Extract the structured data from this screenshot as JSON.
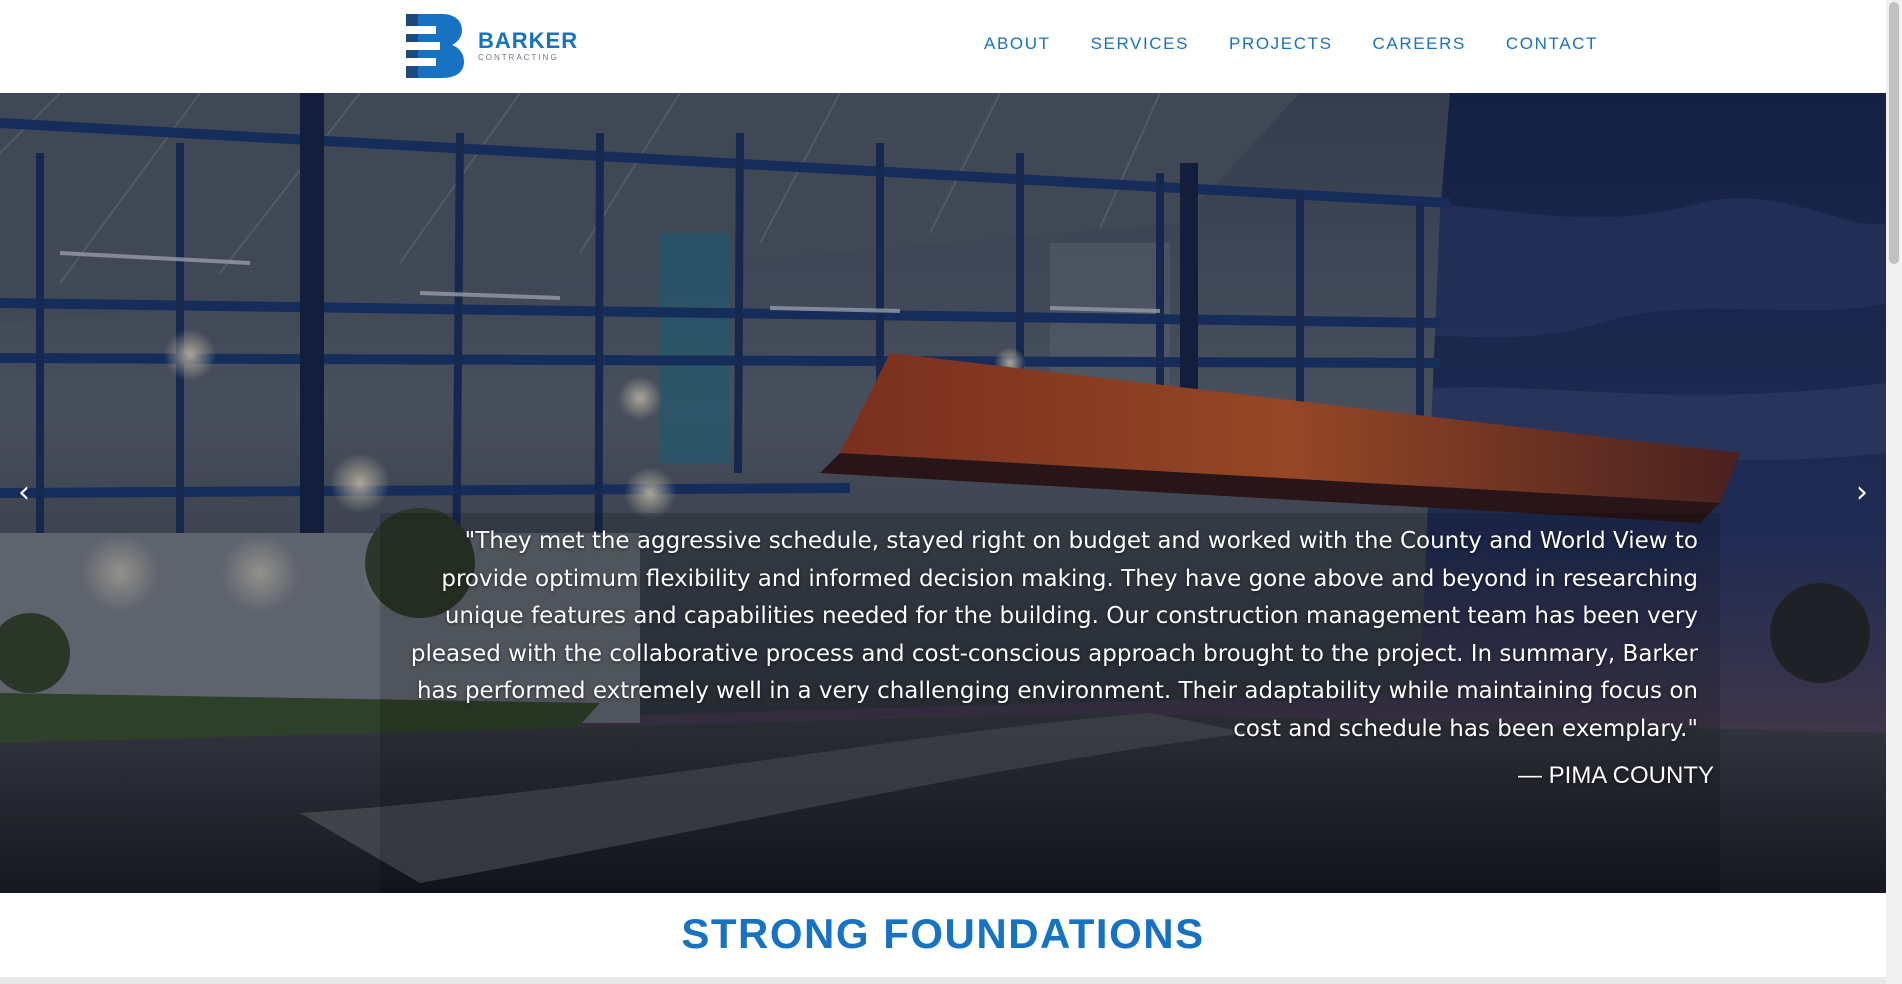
{
  "brand": {
    "name": "BARKER",
    "tagline": "CONTRACTING",
    "color": "#1772c2"
  },
  "nav": {
    "items": [
      {
        "label": "ABOUT"
      },
      {
        "label": "SERVICES"
      },
      {
        "label": "PROJECTS"
      },
      {
        "label": "CAREERS"
      },
      {
        "label": "CONTACT"
      }
    ]
  },
  "hero": {
    "prev_icon": "‹",
    "next_icon": "›",
    "quote": "\"They met the aggressive schedule, stayed right on budget and worked with the County and World View to provide optimum flexibility and informed decision making. They have gone above and beyond in researching unique features and capabilities needed for the building. Our construction management team has been very pleased with the collaborative process and cost-conscious approach brought to the project. In summary, Barker has performed extremely well in a very challenging environment. Their adaptability while maintaining focus on cost and schedule has been exemplary.\"",
    "author": "— PIMA COUNTY",
    "icons": {
      "prev": "chevron-left-icon",
      "next": "chevron-right-icon"
    }
  },
  "section": {
    "title": "STRONG FOUNDATIONS"
  }
}
